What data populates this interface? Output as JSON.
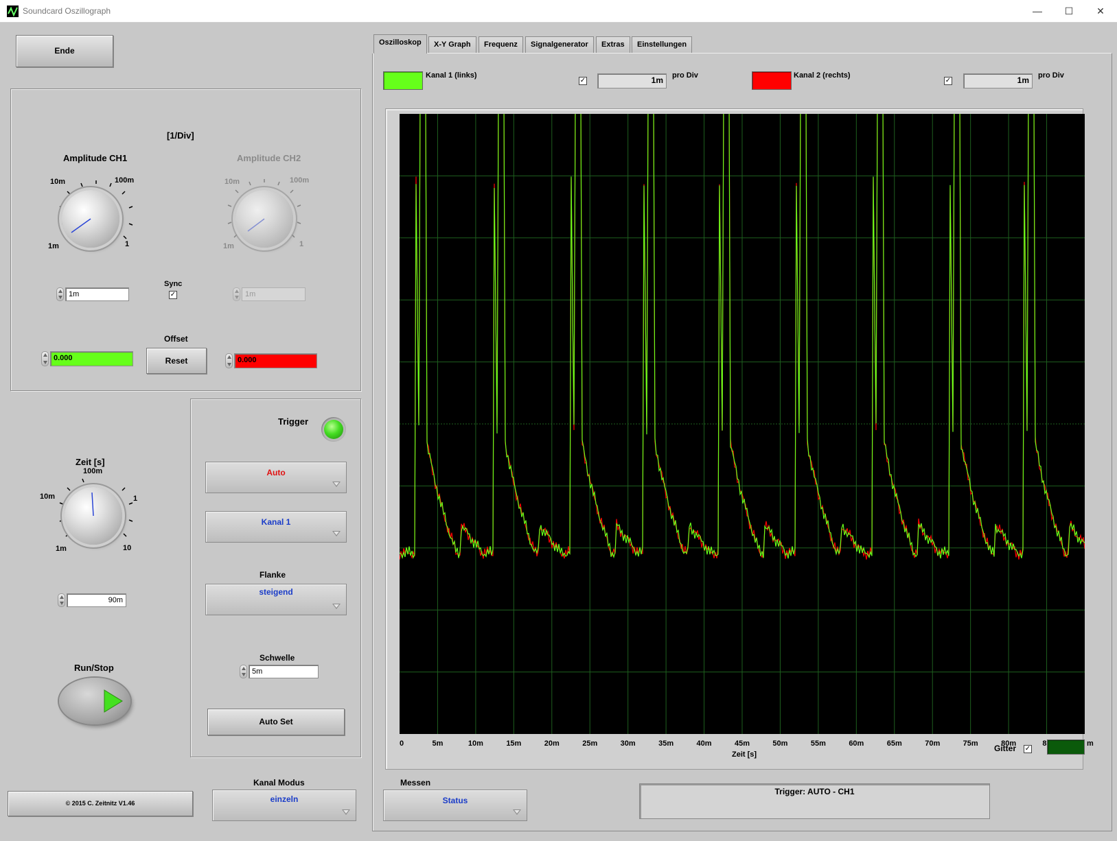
{
  "window": {
    "title": "Soundcard Oszillograph"
  },
  "left": {
    "end_label": "Ende",
    "units_label": "[1/Div]",
    "amp_ch1": {
      "title": "Amplitude CH1",
      "tick_min": "1m",
      "tick_10m": "10m",
      "tick_100m": "100m",
      "tick_max": "1",
      "value": "1m"
    },
    "amp_ch2": {
      "title": "Amplitude CH2",
      "tick_min": "1m",
      "tick_10m": "10m",
      "tick_100m": "100m",
      "tick_max": "1",
      "value": "1m"
    },
    "sync_label": "Sync",
    "offset_label": "Offset",
    "reset_label": "Reset",
    "offset_ch1": "0.000",
    "offset_ch2": "0.000",
    "time": {
      "title": "Zeit [s]",
      "tick_1m": "1m",
      "tick_10m": "10m",
      "tick_100m": "100m",
      "tick_1": "1",
      "tick_10": "10",
      "value": "90m"
    },
    "run_stop_label": "Run/Stop",
    "copyright": "© 2015  C. Zeitnitz V1.46",
    "kanal_modus_label": "Kanal Modus",
    "kanal_modus_value": "einzeln"
  },
  "trigger": {
    "title": "Trigger",
    "mode": "Auto",
    "channel": "Kanal 1",
    "flanke_label": "Flanke",
    "flanke_value": "steigend",
    "schwelle_label": "Schwelle",
    "schwelle_value": "5m",
    "autoset_label": "Auto Set"
  },
  "tabs": [
    "Oszilloskop",
    "X-Y Graph",
    "Frequenz",
    "Signalgenerator",
    "Extras",
    "Einstellungen"
  ],
  "channels": {
    "ch1_label": "Kanal 1 (links)",
    "ch1_per_div": "1m",
    "ch2_label": "Kanal 2 (rechts)",
    "ch2_per_div": "1m",
    "per_div_label": "pro Div"
  },
  "graph": {
    "x_label": "Zeit [s]",
    "x_ticks": [
      "0",
      "5m",
      "10m",
      "15m",
      "20m",
      "25m",
      "30m",
      "35m",
      "40m",
      "45m",
      "50m",
      "55m",
      "60m",
      "65m",
      "70m",
      "75m",
      "80m",
      "85"
    ],
    "x_tail": "m",
    "gitter_label": "Gitter"
  },
  "measure": {
    "title": "Messen",
    "value": "Status",
    "status_text": "Trigger: AUTO - CH1"
  },
  "colors": {
    "ch1": "#66ff1a",
    "ch2": "#ff0000",
    "grid": "#1e5f1e",
    "grid_swatch": "#0b5a0b",
    "led": "#44dd22",
    "blue_text": "#1a3cc8",
    "red_text": "#e01010"
  }
}
